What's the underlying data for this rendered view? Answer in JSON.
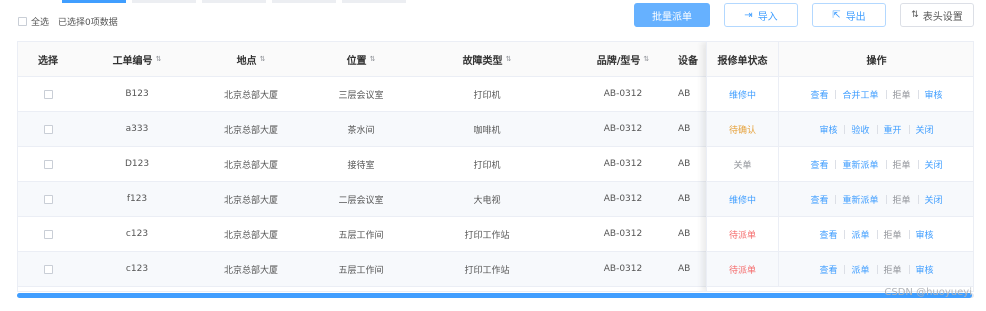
{
  "selection": {
    "select_all_label": "全选",
    "selected_text": "已选择0项数据"
  },
  "toolbar": {
    "batch_dispatch": "批量派单",
    "import": "导入",
    "export": "导出",
    "header_settings": "表头设置"
  },
  "table": {
    "columns": {
      "select": "选择",
      "work_no": "工单编号",
      "location": "地点",
      "position": "位置",
      "fault_type": "故障类型",
      "brand_model": "品牌/型号",
      "device": "设备",
      "status": "报修单状态",
      "actions": "操作"
    },
    "rows": [
      {
        "work_no": "B123",
        "location": "北京总部大厦",
        "position": "三层会议室",
        "fault_type": "打印机",
        "brand_model": "AB-0312",
        "device": "AB",
        "status": "维修中",
        "status_color": "#409eff",
        "actions": [
          "查看",
          "合并工单",
          "拒单",
          "审核"
        ],
        "actions_style": [
          "blue",
          "blue",
          "gray",
          "blue"
        ]
      },
      {
        "work_no": "a333",
        "location": "北京总部大厦",
        "position": "茶水间",
        "fault_type": "咖啡机",
        "brand_model": "AB-0312",
        "device": "AB",
        "status": "待确认",
        "status_color": "#e6a23c",
        "actions": [
          "审核",
          "验收",
          "重开",
          "关闭"
        ],
        "actions_style": [
          "blue",
          "blue",
          "blue",
          "blue"
        ]
      },
      {
        "work_no": "D123",
        "location": "北京总部大厦",
        "position": "接待室",
        "fault_type": "打印机",
        "brand_model": "AB-0312",
        "device": "AB",
        "status": "关单",
        "status_color": "#909399",
        "actions": [
          "查看",
          "重新派单",
          "拒单",
          "关闭"
        ],
        "actions_style": [
          "blue",
          "blue",
          "gray",
          "blue"
        ]
      },
      {
        "work_no": "f123",
        "location": "北京总部大厦",
        "position": "二层会议室",
        "fault_type": "大电视",
        "brand_model": "AB-0312",
        "device": "AB",
        "status": "维修中",
        "status_color": "#409eff",
        "actions": [
          "查看",
          "重新派单",
          "拒单",
          "关闭"
        ],
        "actions_style": [
          "blue",
          "blue",
          "gray",
          "blue"
        ]
      },
      {
        "work_no": "c123",
        "location": "北京总部大厦",
        "position": "五层工作间",
        "fault_type": "打印工作站",
        "brand_model": "AB-0312",
        "device": "AB",
        "status": "待派单",
        "status_color": "#f56c6c",
        "actions": [
          "查看",
          "派单",
          "拒单",
          "审核"
        ],
        "actions_style": [
          "blue",
          "blue",
          "gray",
          "blue"
        ]
      },
      {
        "work_no": "c123",
        "location": "北京总部大厦",
        "position": "五层工作间",
        "fault_type": "打印工作站",
        "brand_model": "AB-0312",
        "device": "AB",
        "status": "待派单",
        "status_color": "#f56c6c",
        "actions": [
          "查看",
          "派单",
          "拒单",
          "审核"
        ],
        "actions_style": [
          "blue",
          "blue",
          "gray",
          "blue"
        ]
      }
    ]
  },
  "watermark": "CSDN @huoyueyi"
}
